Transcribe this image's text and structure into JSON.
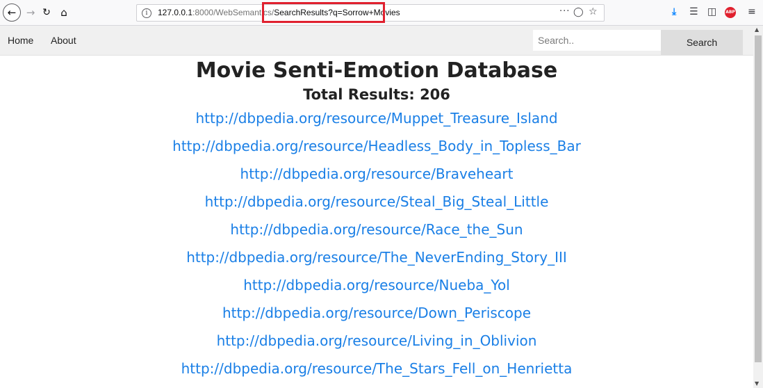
{
  "browser": {
    "url_host": "127.0.0.1",
    "url_path_dim": ":8000/WebSemantics/",
    "url_query": "SearchResults?q=Sorrow+Movies",
    "icons": {
      "back": "back-arrow-icon",
      "forward": "forward-arrow-icon",
      "reload": "reload-icon",
      "home": "home-icon",
      "info": "info-icon",
      "more": "more-actions-icon",
      "pocket": "pocket-icon",
      "bookmark": "star-icon",
      "download": "download-icon",
      "library": "library-icon",
      "sidebar": "sidebar-icon",
      "adblock": "adblock-icon",
      "menu": "hamburger-menu-icon"
    },
    "highlight_color": "#e0202e"
  },
  "navbar": {
    "home_label": "Home",
    "about_label": "About",
    "search_placeholder": "Search..",
    "search_button_label": "Search"
  },
  "main": {
    "title": "Movie Senti-Emotion Database",
    "total_results": "Total Results: 206",
    "link_color": "#1a7fe6",
    "results": [
      "http://dbpedia.org/resource/Muppet_Treasure_Island",
      "http://dbpedia.org/resource/Headless_Body_in_Topless_Bar",
      "http://dbpedia.org/resource/Braveheart",
      "http://dbpedia.org/resource/Steal_Big_Steal_Little",
      "http://dbpedia.org/resource/Race_the_Sun",
      "http://dbpedia.org/resource/The_NeverEnding_Story_III",
      "http://dbpedia.org/resource/Nueba_Yol",
      "http://dbpedia.org/resource/Down_Periscope",
      "http://dbpedia.org/resource/Living_in_Oblivion",
      "http://dbpedia.org/resource/The_Stars_Fell_on_Henrietta"
    ]
  }
}
